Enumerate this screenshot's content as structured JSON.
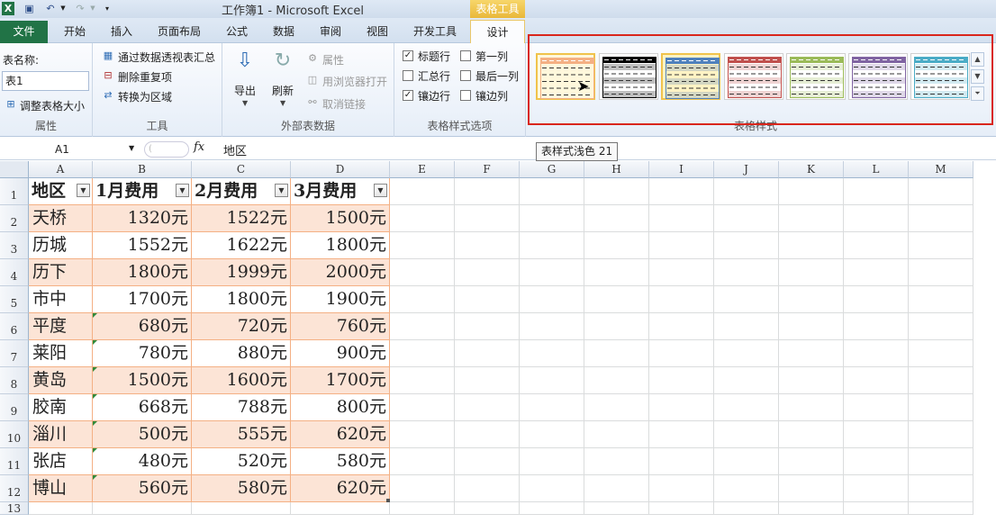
{
  "title": "工作簿1 - Microsoft Excel",
  "context_header": "表格工具",
  "tabs": [
    "文件",
    "开始",
    "插入",
    "页面布局",
    "公式",
    "数据",
    "审阅",
    "视图",
    "开发工具",
    "设计"
  ],
  "ribbon": {
    "properties": {
      "table_name_label": "表名称:",
      "table_name_value": "表1",
      "resize_label": "调整表格大小",
      "group_label": "属性"
    },
    "tools": {
      "pivot_label": "通过数据透视表汇总",
      "remove_dup_label": "删除重复项",
      "convert_label": "转换为区域",
      "group_label": "工具"
    },
    "external": {
      "export_label": "导出",
      "refresh_label": "刷新",
      "properties_label": "属性",
      "browser_label": "用浏览器打开",
      "unlink_label": "取消链接",
      "group_label": "外部表数据"
    },
    "style_options": {
      "header_row": "标题行",
      "total_row": "汇总行",
      "banded_rows": "镶边行",
      "first_col": "第一列",
      "last_col": "最后一列",
      "banded_cols": "镶边列",
      "header_row_checked": true,
      "total_row_checked": false,
      "banded_rows_checked": true,
      "first_col_checked": false,
      "last_col_checked": false,
      "banded_cols_checked": false,
      "group_label": "表格样式选项"
    },
    "styles": {
      "group_label": "表格样式",
      "swatch_colors": [
        "#f4b084",
        "#000000",
        "#4f81bd",
        "#c0504d",
        "#9bbb59",
        "#8064a2",
        "#4bacc6"
      ],
      "selected_index": 2,
      "hover_index": 0
    }
  },
  "tooltip": "表样式浅色 21",
  "formula_bar": {
    "name_box": "A1",
    "fx": "fx",
    "content": "地区"
  },
  "grid": {
    "columns": [
      "A",
      "B",
      "C",
      "D",
      "E",
      "F",
      "G",
      "H",
      "I",
      "J",
      "K",
      "L",
      "M"
    ],
    "rows": [
      "1",
      "2",
      "3",
      "4",
      "5",
      "6",
      "7",
      "8",
      "9",
      "10",
      "11",
      "12",
      "13"
    ],
    "headers": [
      "地区",
      "1月费用",
      "2月费用",
      "3月费用"
    ],
    "data": [
      [
        "天桥",
        "1320元",
        "1522元",
        "1500元"
      ],
      [
        "历城",
        "1552元",
        "1622元",
        "1800元"
      ],
      [
        "历下",
        "1800元",
        "1999元",
        "2000元"
      ],
      [
        "市中",
        "1700元",
        "1800元",
        "1900元"
      ],
      [
        "平度",
        "680元",
        "720元",
        "760元"
      ],
      [
        "莱阳",
        "780元",
        "880元",
        "900元"
      ],
      [
        "黄岛",
        "1500元",
        "1600元",
        "1700元"
      ],
      [
        "胶南",
        "668元",
        "788元",
        "800元"
      ],
      [
        "淄川",
        "500元",
        "555元",
        "620元"
      ],
      [
        "张店",
        "480元",
        "520元",
        "580元"
      ],
      [
        "博山",
        "560元",
        "580元",
        "620元"
      ]
    ]
  },
  "colors": {
    "band": "#fce4d6",
    "table_border": "#f4b084",
    "file_tab": "#217346",
    "highlight_frame": "#d9261c"
  }
}
